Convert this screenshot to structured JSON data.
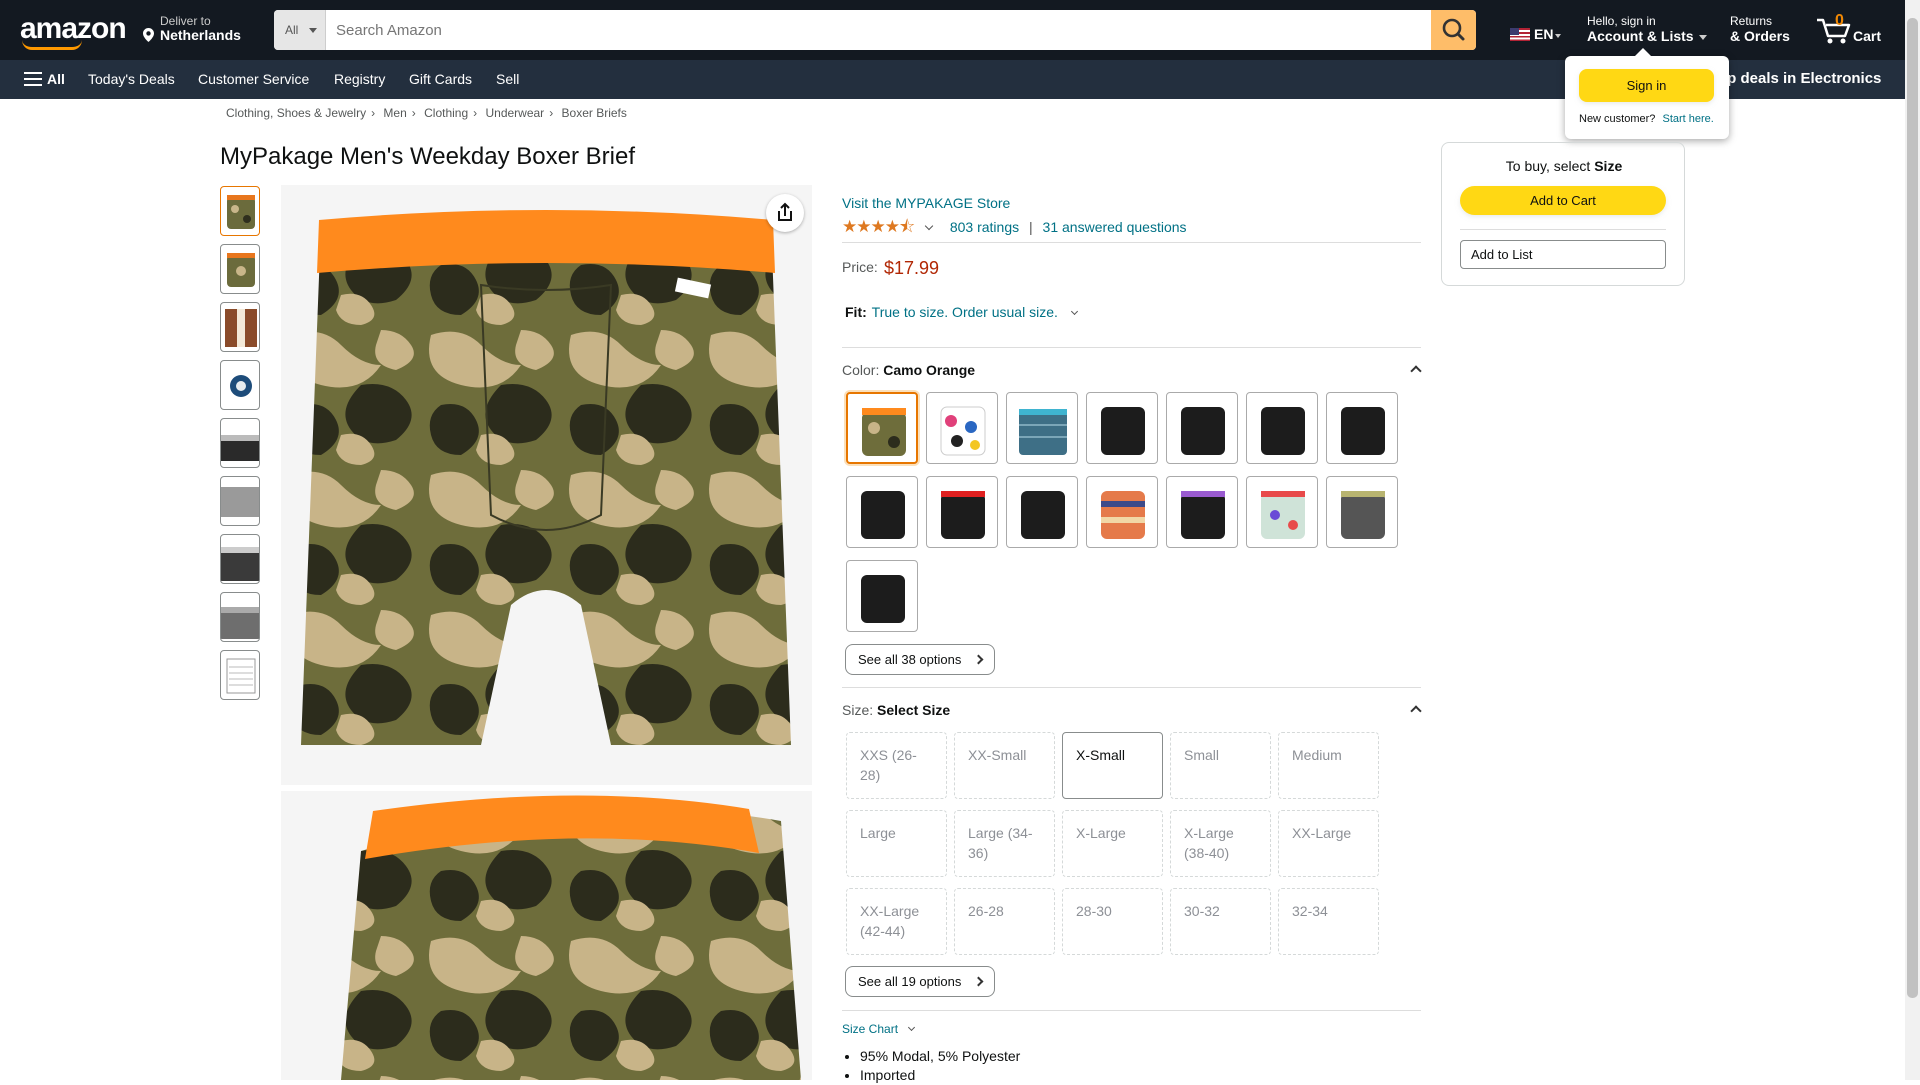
{
  "header": {
    "logo": "amazon",
    "deliver_line1": "Deliver to",
    "deliver_line2": "Netherlands",
    "search_category": "All",
    "search_placeholder": "Search Amazon",
    "lang": "EN",
    "account_line1": "Hello, sign in",
    "account_line2": "Account & Lists",
    "returns_line1": "Returns",
    "returns_line2": "& Orders",
    "cart_count": "0",
    "cart_label": "Cart"
  },
  "subnav": {
    "all": "All",
    "items": [
      "Today's Deals",
      "Customer Service",
      "Registry",
      "Gift Cards",
      "Sell"
    ],
    "promo": "op deals in Electronics"
  },
  "signin_popup": {
    "button": "Sign in",
    "new_customer": "New customer?",
    "start_here": "Start here."
  },
  "breadcrumb": [
    "Clothing, Shoes & Jewelry",
    "Men",
    "Clothing",
    "Underwear",
    "Boxer Briefs"
  ],
  "product": {
    "title": "MyPakage Men's Weekday Boxer Brief",
    "store_link": "Visit the MYPAKAGE Store",
    "rating_stars": 4.5,
    "ratings": "803 ratings",
    "answered": "31 answered questions",
    "price_label": "Price:",
    "price": "$17.99",
    "fit_label": "Fit:",
    "fit_value": "True to size. Order usual size.",
    "color_label": "Color:",
    "color_value": "Camo Orange",
    "see_all_colors": "See all 38 options",
    "size_label": "Size:",
    "size_value": "Select Size",
    "sizes": [
      "XXS (26-28)",
      "XX-Small",
      "X-Small",
      "Small",
      "Medium",
      "Large",
      "Large (34-36)",
      "X-Large",
      "X-Large (38-40)",
      "XX-Large",
      "XX-Large (42-44)",
      "26-28",
      "28-30",
      "30-32",
      "32-34"
    ],
    "see_all_sizes": "See all 19 options",
    "size_chart": "Size Chart",
    "bullets": [
      "95% Modal, 5% Polyester",
      "Imported"
    ]
  },
  "buybox": {
    "to_buy": "To buy, select",
    "to_buy_bold": "Size",
    "add_to_cart": "Add to Cart",
    "add_to_list": "Add to List"
  },
  "colors": {
    "accent": "#ff9900",
    "price": "#b12704",
    "link": "#007185",
    "header_bg": "#131921",
    "subnav_bg": "#232f3e",
    "button_yellow": "#ffd814"
  }
}
